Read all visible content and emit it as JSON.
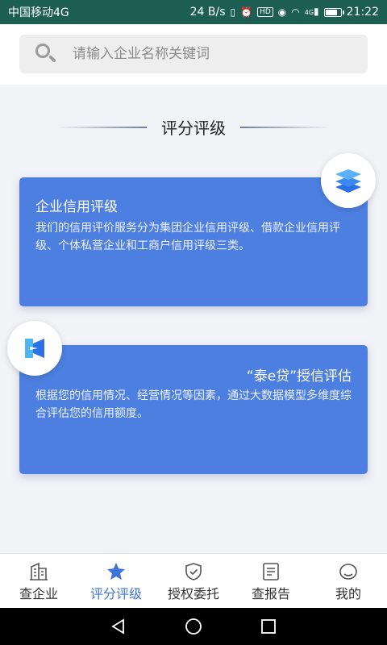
{
  "status": {
    "carrier": "中国移动4G",
    "speed": "24 B/s",
    "time": "21:22",
    "net_badge": "HD",
    "signal_label": "4G",
    "battery_level": 0.82
  },
  "search": {
    "placeholder": "请输入企业名称关键词"
  },
  "section": {
    "title": "评分评级"
  },
  "cards": [
    {
      "title": "企业信用评级",
      "desc": "我们的信用评价服务分为集团企业信用评级、借款企业信用评级、个体私营企业和工商户信用评级三类。",
      "icon": "layers-icon"
    },
    {
      "title": "“泰e贷”授信评估",
      "desc": "根据您的信用情况、经营情况等因素，通过大数据模型多维度综合评估您的信用额度。",
      "icon": "loan-icon"
    }
  ],
  "tabs": [
    {
      "label": "查企业",
      "icon": "building-icon",
      "active": false
    },
    {
      "label": "评分评级",
      "icon": "star-icon",
      "active": true
    },
    {
      "label": "授权委托",
      "icon": "shield-check-icon",
      "active": false
    },
    {
      "label": "查报告",
      "icon": "report-icon",
      "active": false
    },
    {
      "label": "我的",
      "icon": "profile-icon",
      "active": false
    }
  ],
  "colors": {
    "status_bar": "#1c5e52",
    "card": "#4d7fe0",
    "accent": "#3d73d9"
  }
}
